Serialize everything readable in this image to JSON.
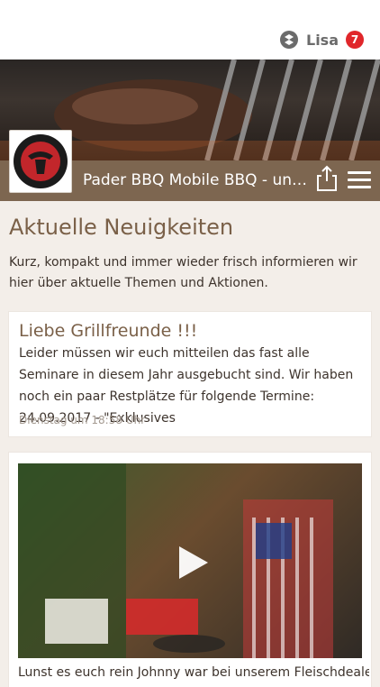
{
  "user": {
    "name": "Lisa",
    "badge_count": "7"
  },
  "app": {
    "title": "Pader BBQ Mobile BBQ - und..."
  },
  "page": {
    "title": "Aktuelle Neuigkeiten",
    "intro": "Kurz, kompakt und immer wieder frisch informieren wir hier über aktuelle Themen und Aktionen."
  },
  "posts": [
    {
      "title": "Liebe Grillfreunde !!!",
      "text": "Leider müssen wir euch mitteilen das fast alle Seminare in diesem Jahr ausgebucht sind. Wir haben noch ein paar Restplätze für folgende Termine: 24.09.2017 - \"Exklusives",
      "date": "Dienstag um 18:58 Uhr"
    },
    {
      "text": "Lunst es euch rein Johnny war bei unserem Fleischdealer"
    }
  ],
  "colors": {
    "accent": "#7d6650",
    "title_brown": "#7a6048",
    "badge_red": "#e0262a"
  }
}
